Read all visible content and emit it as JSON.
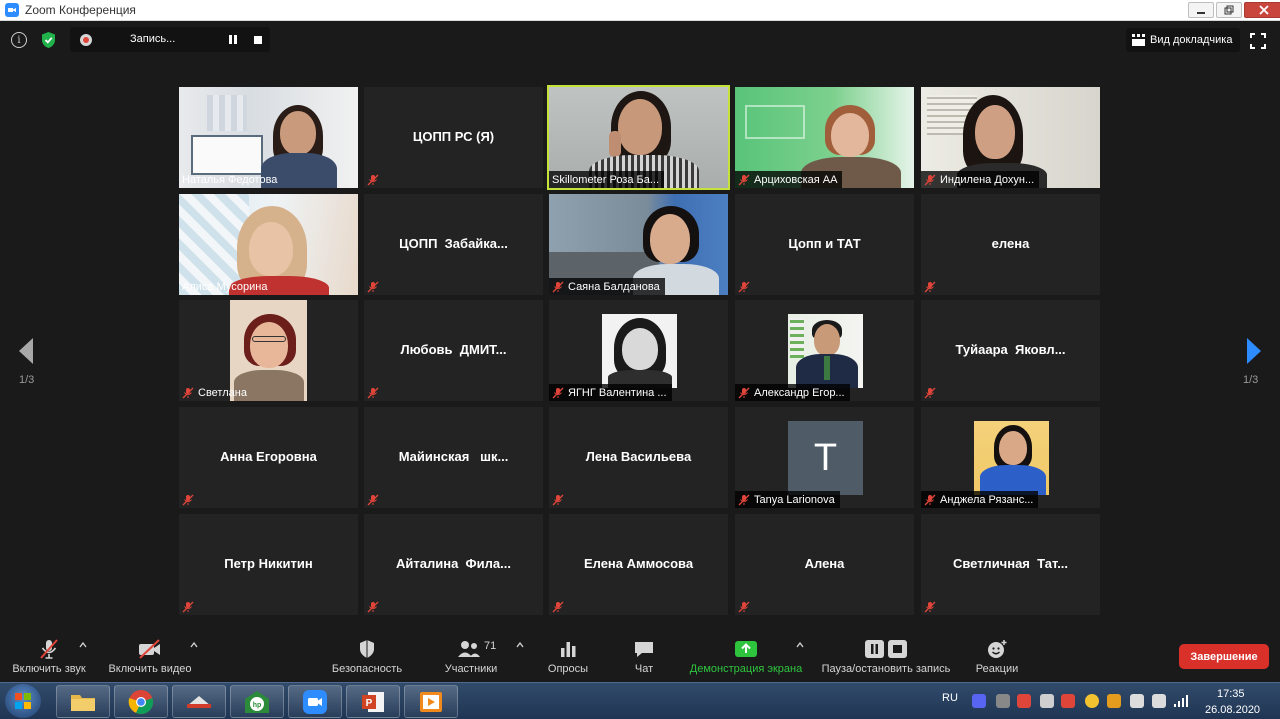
{
  "window": {
    "title": "Zoom Конференция"
  },
  "top_bar": {
    "recording_label": "Запись...",
    "speaker_view_label": "Вид докладчика"
  },
  "pagination": {
    "left": "1/3",
    "right": "1/3"
  },
  "participants": [
    {
      "name": "Наталья Федотова",
      "video": true,
      "muted": false
    },
    {
      "name": "ЦОПП РС (Я)",
      "display": "ЦОПП РС (Я)",
      "video": false,
      "muted": true
    },
    {
      "name": "Skillometer Роза Ба...",
      "video": true,
      "muted": false,
      "active_speaker": true
    },
    {
      "name": "Арциховская АА",
      "video": true,
      "muted": true
    },
    {
      "name": "Индилена Дохун...",
      "video": true,
      "muted": true
    },
    {
      "name": "Алиса Мусорина",
      "video": true,
      "muted": false
    },
    {
      "name": "ЦОПП  Забайка...",
      "display": "ЦОПП  Забайка...",
      "video": false,
      "muted": true
    },
    {
      "name": "Саяна Балданова",
      "video": true,
      "muted": true
    },
    {
      "name": "Цопп и ТАТ",
      "display": "Цопп и ТАТ",
      "video": false,
      "muted": true
    },
    {
      "name": "елена",
      "display": "елена",
      "video": false,
      "muted": true
    },
    {
      "name": "Светлана",
      "video": "photo",
      "muted": true
    },
    {
      "name": "Любовь  ДМИТ...",
      "display": "Любовь  ДМИТ...",
      "video": false,
      "muted": true
    },
    {
      "name": "ЯГНГ Валентина ...",
      "video": "photo",
      "muted": true
    },
    {
      "name": "Александр Егор...",
      "video": "photo",
      "muted": true
    },
    {
      "name": "Туйаара  Яковл...",
      "display": "Туйаара  Яковл...",
      "video": false,
      "muted": true
    },
    {
      "name": "Анна Егоровна",
      "display": "Анна Егоровна",
      "video": false,
      "muted": true
    },
    {
      "name": "Майинская   шк...",
      "display": "Майинская   шк...",
      "video": false,
      "muted": true
    },
    {
      "name": "Лена Васильева",
      "display": "Лена Васильева",
      "video": false,
      "muted": true
    },
    {
      "name": "Tanya Larionova",
      "video": "initial",
      "initial": "T",
      "muted": true
    },
    {
      "name": "Анджела Рязанс...",
      "video": "photo",
      "muted": true
    },
    {
      "name": "Петр Никитин",
      "display": "Петр Никитин",
      "video": false,
      "muted": true
    },
    {
      "name": "Айталина  Фила...",
      "display": "Айталина  Фила...",
      "video": false,
      "muted": true
    },
    {
      "name": "Елена Аммосова",
      "display": "Елена Аммосова",
      "video": false,
      "muted": true
    },
    {
      "name": "Алена",
      "display": "Алена",
      "video": false,
      "muted": true
    },
    {
      "name": "Светличная  Тат...",
      "display": "Светличная  Тат...",
      "video": false,
      "muted": true
    }
  ],
  "toolbar": {
    "unmute": "Включить звук",
    "start_video": "Включить видео",
    "security": "Безопасность",
    "participants": "Участники",
    "participants_count": "71",
    "polls": "Опросы",
    "chat": "Чат",
    "share_screen": "Демонстрация экрана",
    "pause_stop_recording": "Пауза/остановить запись",
    "reactions": "Реакции",
    "end": "Завершение"
  },
  "taskbar": {
    "language": "RU",
    "time": "17:35",
    "date": "26.08.2020"
  },
  "colors": {
    "active_speaker_border": "#c5e23a",
    "share_green": "#2ec43e",
    "end_red": "#d9302a",
    "mute_red": "#e0453a",
    "arrow_blue": "#2d8cff"
  }
}
